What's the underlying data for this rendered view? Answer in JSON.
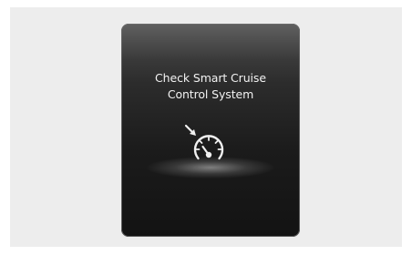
{
  "cluster": {
    "message_line_1": "Check Smart Cruise",
    "message_line_2": "Control System",
    "icon": "smart-cruise-control-icon"
  }
}
